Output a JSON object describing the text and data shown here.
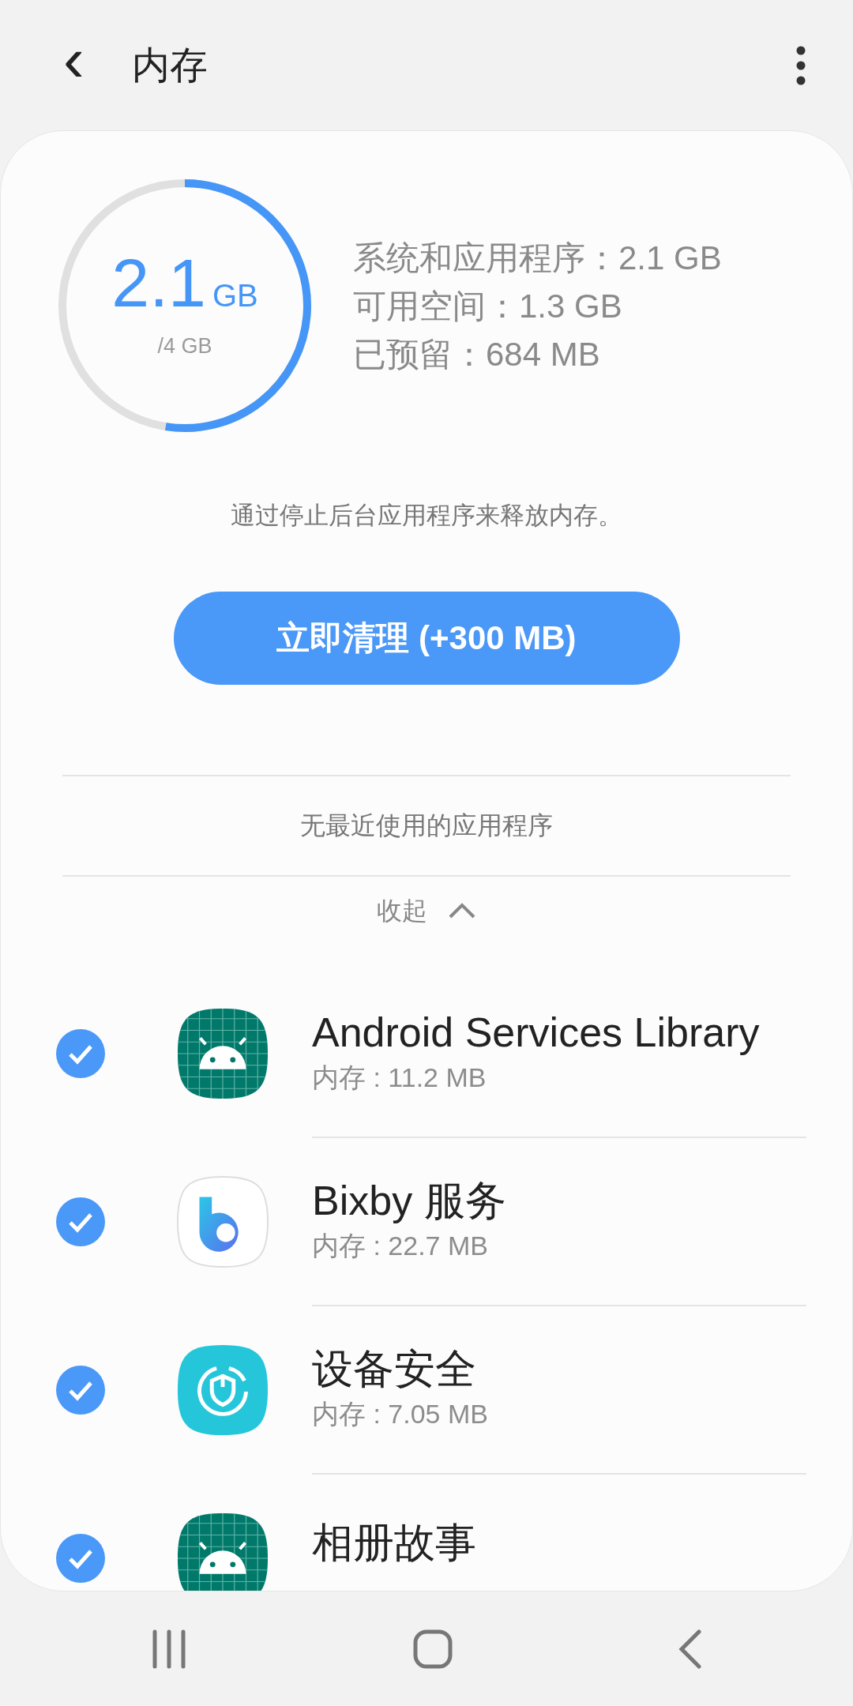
{
  "header": {
    "back": "‹",
    "title": "内存"
  },
  "usage": {
    "value": "2.1",
    "unit": "GB",
    "total": "/4 GB",
    "level": 0.525,
    "details": [
      "系统和应用程序：2.1 GB",
      "可用空间：1.3 GB",
      "已预留：684 MB"
    ]
  },
  "description": "通过停止后台应用程序来释放内存。",
  "clean_button": "立即清理 (+300 MB)",
  "recent_apps": "无最近使用的应用程序",
  "collapse": {
    "label": "收起",
    "expanded": true
  },
  "apps": [
    {
      "name": "Android Services Library",
      "memory": "内存 : 11.2 MB",
      "checked": true,
      "kind": "android"
    },
    {
      "name": "Bixby 服务",
      "memory": "内存 : 22.7 MB",
      "checked": true,
      "kind": "bixby"
    },
    {
      "name": "设备安全",
      "memory": "内存 : 7.05 MB",
      "checked": true,
      "kind": "security"
    },
    {
      "name": "相册故事",
      "checked": true,
      "kind": "android"
    }
  ]
}
